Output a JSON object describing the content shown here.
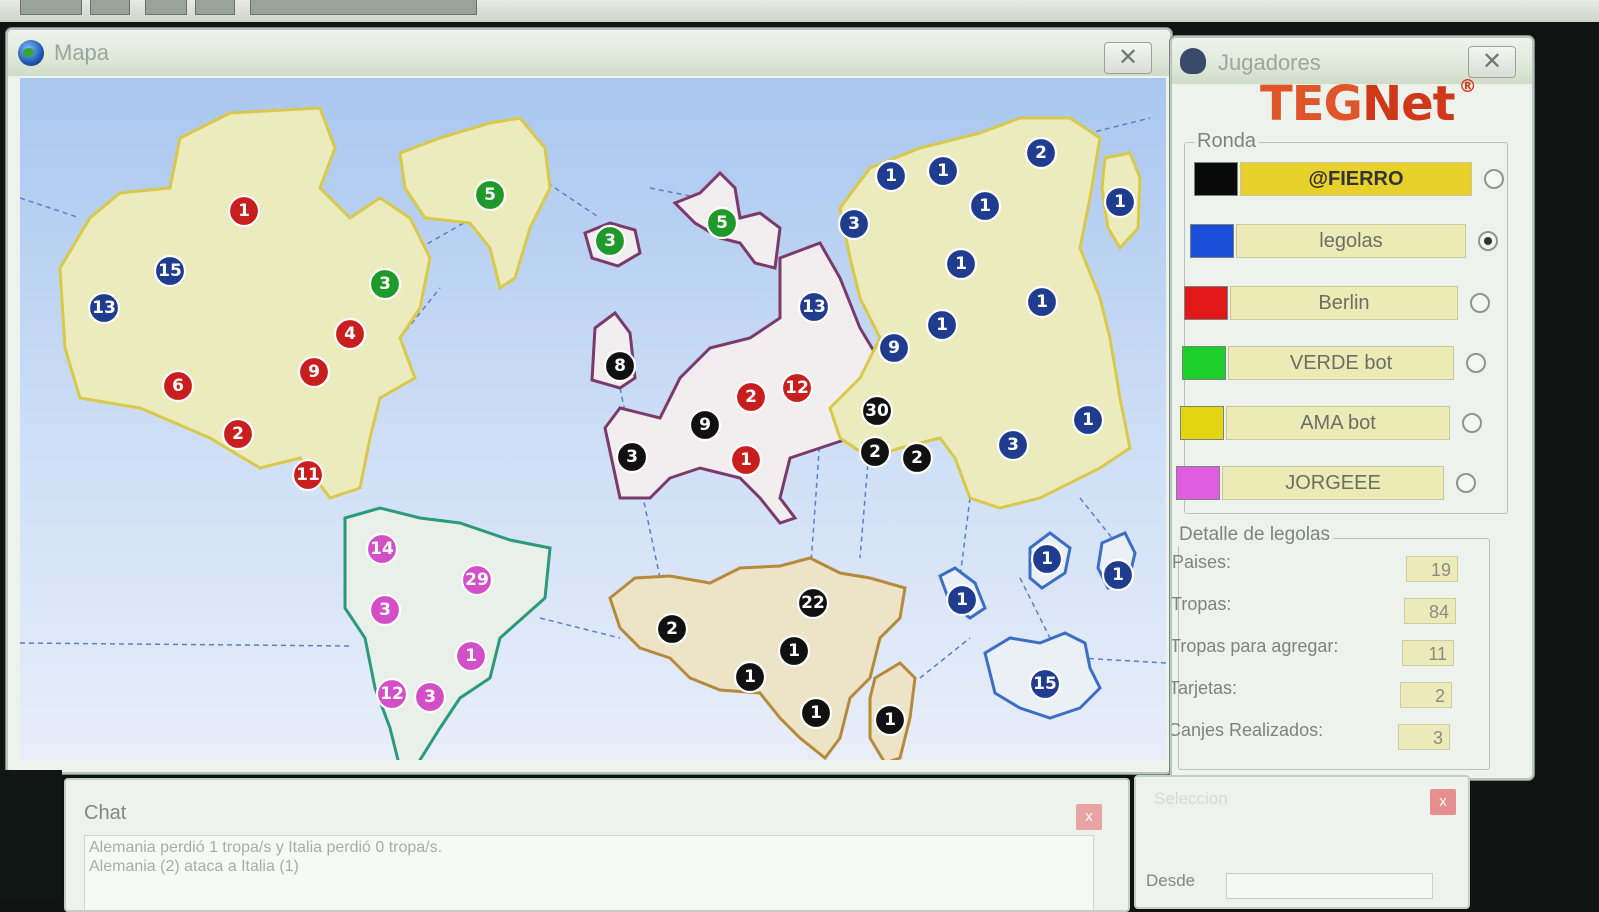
{
  "map_window": {
    "title": "Mapa",
    "close_glyph": "✕",
    "armies": [
      {
        "color": "#c81e1e",
        "n": "1"
      },
      {
        "color": "#1f3c8f",
        "n": "15"
      },
      {
        "color": "#1f3c8f",
        "n": "13"
      },
      {
        "color": "#c81e1e",
        "n": "6"
      },
      {
        "color": "#c81e1e",
        "n": "2"
      },
      {
        "color": "#c81e1e",
        "n": "11"
      },
      {
        "color": "#c81e1e",
        "n": "9"
      },
      {
        "color": "#c81e1e",
        "n": "4"
      },
      {
        "color": "#1f9a2a",
        "n": "3"
      },
      {
        "color": "#1f9a2a",
        "n": "5"
      },
      {
        "color": "#1f9a2a",
        "n": "3"
      },
      {
        "color": "#1f9a2a",
        "n": "5"
      },
      {
        "color": "#111111",
        "n": "8"
      },
      {
        "color": "#111111",
        "n": "3"
      },
      {
        "color": "#111111",
        "n": "9"
      },
      {
        "color": "#c81e1e",
        "n": "2"
      },
      {
        "color": "#c81e1e",
        "n": "12"
      },
      {
        "color": "#c81e1e",
        "n": "1"
      },
      {
        "color": "#1f3c8f",
        "n": "13"
      },
      {
        "color": "#1f3c8f",
        "n": "9"
      },
      {
        "color": "#111111",
        "n": "30"
      },
      {
        "color": "#111111",
        "n": "2"
      },
      {
        "color": "#111111",
        "n": "2"
      },
      {
        "color": "#1f3c8f",
        "n": "1"
      },
      {
        "color": "#1f3c8f",
        "n": "1"
      },
      {
        "color": "#1f3c8f",
        "n": "3"
      },
      {
        "color": "#1f3c8f",
        "n": "1"
      },
      {
        "color": "#1f3c8f",
        "n": "2"
      },
      {
        "color": "#1f3c8f",
        "n": "1"
      },
      {
        "color": "#1f3c8f",
        "n": "1"
      },
      {
        "color": "#1f3c8f",
        "n": "1"
      },
      {
        "color": "#1f3c8f",
        "n": "1"
      },
      {
        "color": "#1f3c8f",
        "n": "3"
      },
      {
        "color": "#1f3c8f",
        "n": "1"
      },
      {
        "color": "#d24fc7",
        "n": "14"
      },
      {
        "color": "#d24fc7",
        "n": "29"
      },
      {
        "color": "#d24fc7",
        "n": "3"
      },
      {
        "color": "#d24fc7",
        "n": "1"
      },
      {
        "color": "#d24fc7",
        "n": "12"
      },
      {
        "color": "#d24fc7",
        "n": "3"
      },
      {
        "color": "#111111",
        "n": "2"
      },
      {
        "color": "#111111",
        "n": "22"
      },
      {
        "color": "#111111",
        "n": "1"
      },
      {
        "color": "#111111",
        "n": "1"
      },
      {
        "color": "#111111",
        "n": "1"
      },
      {
        "color": "#111111",
        "n": "1"
      },
      {
        "color": "#1f3c8f",
        "n": "1"
      },
      {
        "color": "#1f3c8f",
        "n": "1"
      },
      {
        "color": "#1f3c8f",
        "n": "1"
      },
      {
        "color": "#1f3c8f",
        "n": "15"
      }
    ]
  },
  "players_window": {
    "title": "Jugadores",
    "close_glyph": "✕",
    "logo": {
      "teg": "TEG",
      "net": "Net",
      "reg": "®"
    },
    "round_label": "Ronda",
    "players": [
      {
        "name": "@FIERRO",
        "color": "#0a0a0a",
        "active": true,
        "selected": false
      },
      {
        "name": "legolas",
        "color": "#1a4ed8",
        "active": false,
        "selected": true
      },
      {
        "name": "Berlin",
        "color": "#e01818",
        "active": false,
        "selected": false
      },
      {
        "name": "VERDE bot",
        "color": "#1ccf2a",
        "active": false,
        "selected": false
      },
      {
        "name": "AMA bot",
        "color": "#e3d512",
        "active": false,
        "selected": false
      },
      {
        "name": "JORGEEE",
        "color": "#e05ce0",
        "active": false,
        "selected": false
      }
    ],
    "detail": {
      "label": "Detalle de legolas",
      "rows": [
        {
          "label": "Paises:",
          "value": "19"
        },
        {
          "label": "Tropas:",
          "value": "84"
        },
        {
          "label": "Tropas para agregar:",
          "value": "11"
        },
        {
          "label": "Tarjetas:",
          "value": "2"
        },
        {
          "label": "Canjes Realizados:",
          "value": "3"
        }
      ]
    }
  },
  "chat_window": {
    "title": "Chat",
    "close_glyph": "x",
    "lines": [
      "Alemania perdió 1 tropa/s y Italia perdió 0 tropa/s.",
      "Alemania (2) ataca a Italia (1)"
    ]
  },
  "select_window": {
    "title": "Seleccion",
    "close_glyph": "x",
    "from_label": "Desde"
  }
}
